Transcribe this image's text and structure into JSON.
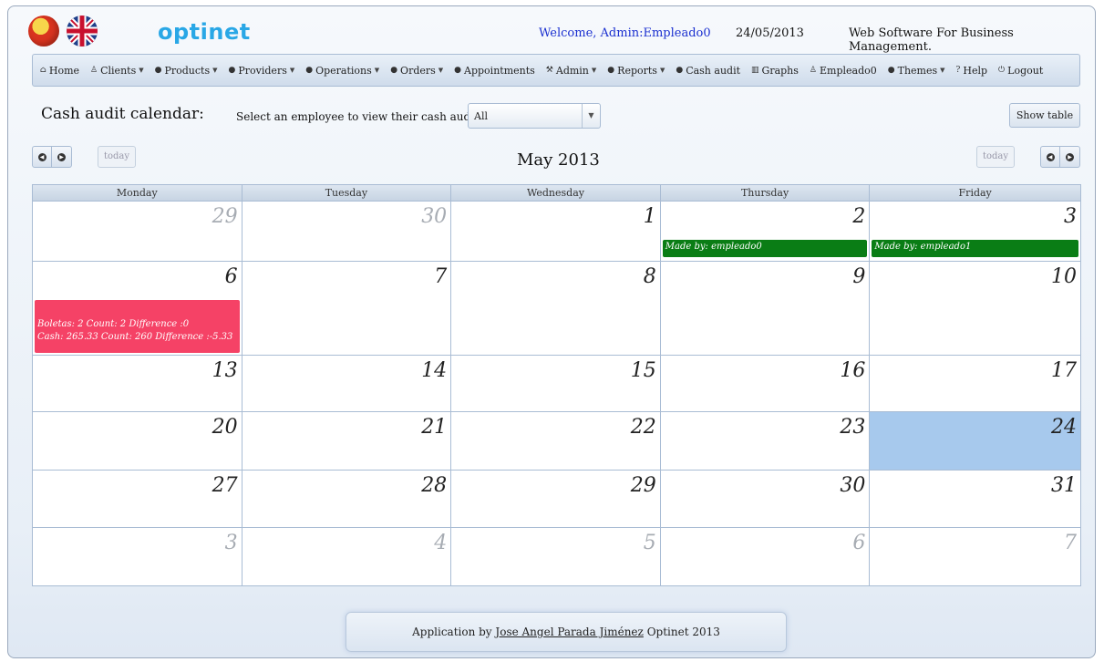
{
  "header": {
    "logo": "optinet",
    "welcome": "Welcome, Admin:Empleado0",
    "date": "24/05/2013",
    "slogan": "Web Software For Business Management."
  },
  "menu": [
    {
      "icon": "home-icon",
      "glyph": "⌂",
      "label": "Home",
      "dropdown": false
    },
    {
      "icon": "user-icon",
      "glyph": "♙",
      "label": "Clients",
      "dropdown": true
    },
    {
      "icon": "bullet-icon",
      "glyph": "●",
      "label": "Products",
      "dropdown": true
    },
    {
      "icon": "bullet-icon",
      "glyph": "●",
      "label": "Providers",
      "dropdown": true
    },
    {
      "icon": "bullet-icon",
      "glyph": "●",
      "label": "Operations",
      "dropdown": true
    },
    {
      "icon": "bullet-icon",
      "glyph": "●",
      "label": "Orders",
      "dropdown": true
    },
    {
      "icon": "bullet-icon",
      "glyph": "●",
      "label": "Appointments",
      "dropdown": false
    },
    {
      "icon": "wrench-icon",
      "glyph": "⚒",
      "label": "Admin",
      "dropdown": true
    },
    {
      "icon": "bullet-icon",
      "glyph": "●",
      "label": "Reports",
      "dropdown": true
    },
    {
      "icon": "bullet-icon",
      "glyph": "●",
      "label": "Cash audit",
      "dropdown": false
    },
    {
      "icon": "chart-icon",
      "glyph": "▥",
      "label": "Graphs",
      "dropdown": false
    },
    {
      "icon": "user-icon",
      "glyph": "♙",
      "label": "Empleado0",
      "dropdown": false
    },
    {
      "icon": "bullet-icon",
      "glyph": "●",
      "label": "Themes",
      "dropdown": true
    },
    {
      "icon": "help-icon",
      "glyph": "?",
      "label": "Help",
      "dropdown": false
    },
    {
      "icon": "power-icon",
      "glyph": "⏻",
      "label": "Logout",
      "dropdown": false
    }
  ],
  "toolbar": {
    "title": "Cash audit calendar:",
    "employee_label": "Select an employee to view their cash audits:",
    "employee_selected": "All",
    "show_table": "Show table"
  },
  "calendar": {
    "today_label": "today",
    "month_title": "May 2013",
    "weekdays": [
      "Monday",
      "Tuesday",
      "Wednesday",
      "Thursday",
      "Friday"
    ],
    "weeks": [
      [
        {
          "day": "29",
          "other": true
        },
        {
          "day": "30",
          "other": true
        },
        {
          "day": "1"
        },
        {
          "day": "2",
          "event": "Made by: empleado0",
          "color": "green"
        },
        {
          "day": "3",
          "event": "Made by: empleado1",
          "color": "green"
        }
      ],
      [
        {
          "day": "6",
          "event_lines": [
            "Boletas: 2 Count: 2 Difference :0",
            "Cash: 265.33 Count: 260 Difference :-5.33"
          ],
          "color": "red"
        },
        {
          "day": "7"
        },
        {
          "day": "8"
        },
        {
          "day": "9"
        },
        {
          "day": "10"
        }
      ],
      [
        {
          "day": "13"
        },
        {
          "day": "14"
        },
        {
          "day": "15"
        },
        {
          "day": "16"
        },
        {
          "day": "17"
        }
      ],
      [
        {
          "day": "20"
        },
        {
          "day": "21"
        },
        {
          "day": "22"
        },
        {
          "day": "23"
        },
        {
          "day": "24",
          "today": true
        }
      ],
      [
        {
          "day": "27"
        },
        {
          "day": "28"
        },
        {
          "day": "29"
        },
        {
          "day": "30"
        },
        {
          "day": "31"
        }
      ],
      [
        {
          "day": "3",
          "other": true
        },
        {
          "day": "4",
          "other": true
        },
        {
          "day": "5",
          "other": true
        },
        {
          "day": "6",
          "other": true
        },
        {
          "day": "7",
          "other": true
        }
      ]
    ]
  },
  "footer": {
    "prefix": "Application by",
    "author": "Jose Angel Parada Jiménez",
    "suffix": "Optinet 2013"
  }
}
